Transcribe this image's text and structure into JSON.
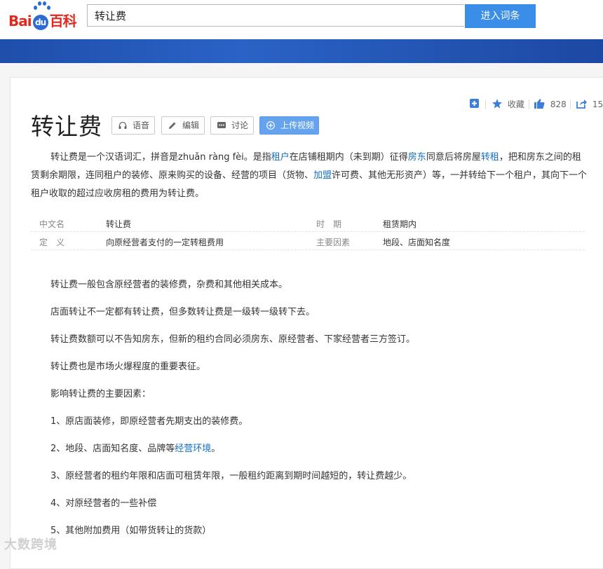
{
  "header": {
    "logo_left": "Bai",
    "logo_du": "du",
    "logo_right": "百科",
    "search_value": "转让费",
    "search_button": "进入词条"
  },
  "toolbar": {
    "add_label": "",
    "collect_label": "收藏",
    "like_count": "828",
    "share_count": "15"
  },
  "entry": {
    "title": "转让费",
    "buttons": {
      "voice": "语音",
      "edit": "编辑",
      "discuss": "讨论",
      "upload_video": "上传视频"
    },
    "summary": {
      "s1": "转让费是一个汉语词汇，拼音是zhuǎn ràng fèi。是指",
      "link1": "租户",
      "s2": "在店铺租期内（未到期）征得",
      "link2": "房东",
      "s3": "同意后将房屋",
      "link3": "转租",
      "s4": "，把和房东之间的租赁剩余期限，连同租户的装修、原来购买的设备、经营的项目（货物、",
      "link4": "加盟",
      "s5": "许可费、其他无形资产）等，一并转给下一个租户，其向下一个租户收取的超过应收房租的费用为转让费。"
    },
    "infobox": [
      {
        "key": "中文名",
        "value": "转让费",
        "key2": "时　期",
        "value2": "租赁期内"
      },
      {
        "key": "定　义",
        "value": "向原经营者支付的一定转租费用",
        "key2": "主要因素",
        "value2": "地段、店面知名度"
      }
    ],
    "body": {
      "p1": "转让费一般包含原经营者的装修费，杂费和其他相关成本。",
      "p2": "店面转让不一定都有转让费，但多数转让费是一级转一级转下去。",
      "p3": "转让费数额可以不告知房东，但新的租约合同必须房东、原经营者、下家经营者三方签订。",
      "p4": "转让费也是市场火爆程度的重要表征。",
      "p5": "影响转让费的主要因素：",
      "p6": "1、原店面装修，即原经营者先期支出的装修费。",
      "p7a": "2、地段、店面知名度、品牌等",
      "p7link": "经营环境",
      "p7b": "。",
      "p8": "3、原经营者的租约年限和店面可租赁年限，一般租约距离到期时间越短的，转让费越少。",
      "p9": "4、对原经营者的一些补偿",
      "p10": "5、其他附加费用（如带货转让的货款）"
    }
  },
  "watermark": "大数跨境",
  "colors": {
    "brand_red": "#de2b1f",
    "brand_blue": "#2e69d8",
    "link": "#136ec2",
    "button_blue": "#3b8ee8"
  }
}
